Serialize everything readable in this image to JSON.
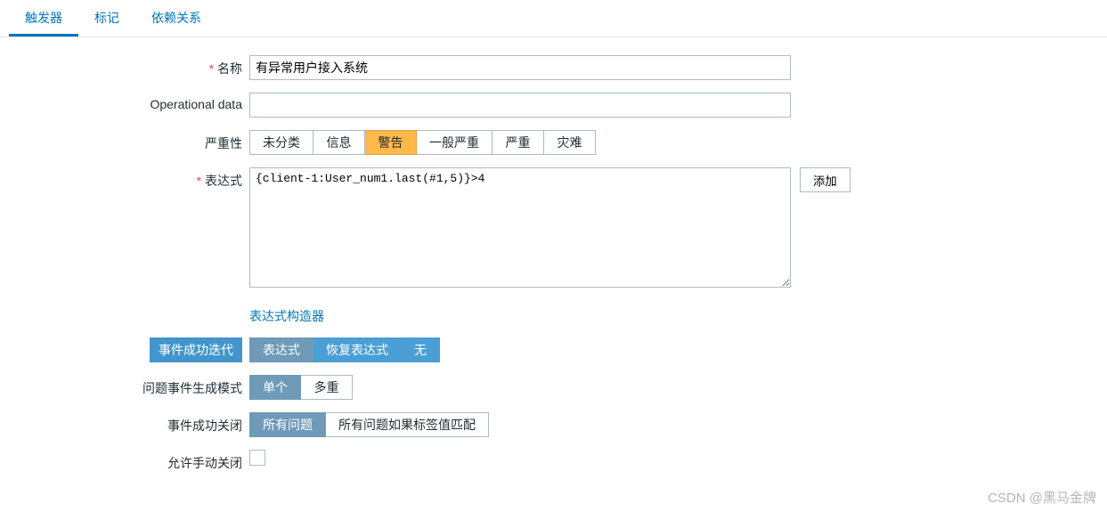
{
  "tabs": {
    "trigger": "触发器",
    "tags": "标记",
    "deps": "依赖关系"
  },
  "form": {
    "name_label": "名称",
    "name_value": "有异常用户接入系统",
    "opdata_label": "Operational data",
    "opdata_value": "",
    "severity_label": "严重性",
    "severity_opts": [
      "未分类",
      "信息",
      "警告",
      "一般严重",
      "严重",
      "灾难"
    ],
    "expr_label": "表达式",
    "expr_value": "{client-1:User_num1.last(#1,5)}>4",
    "add_btn": "添加",
    "expr_builder": "表达式构造器",
    "ok_iter_label": "事件成功迭代",
    "ok_iter_opts": [
      "表达式",
      "恢复表达式",
      "无"
    ],
    "gen_mode_label": "问题事件生成模式",
    "gen_mode_opts": [
      "单个",
      "多重"
    ],
    "ok_close_label": "事件成功关闭",
    "ok_close_opts": [
      "所有问题",
      "所有问题如果标签值匹配"
    ],
    "manual_close_label": "允许手动关闭"
  },
  "watermark": "CSDN @黑马金牌"
}
